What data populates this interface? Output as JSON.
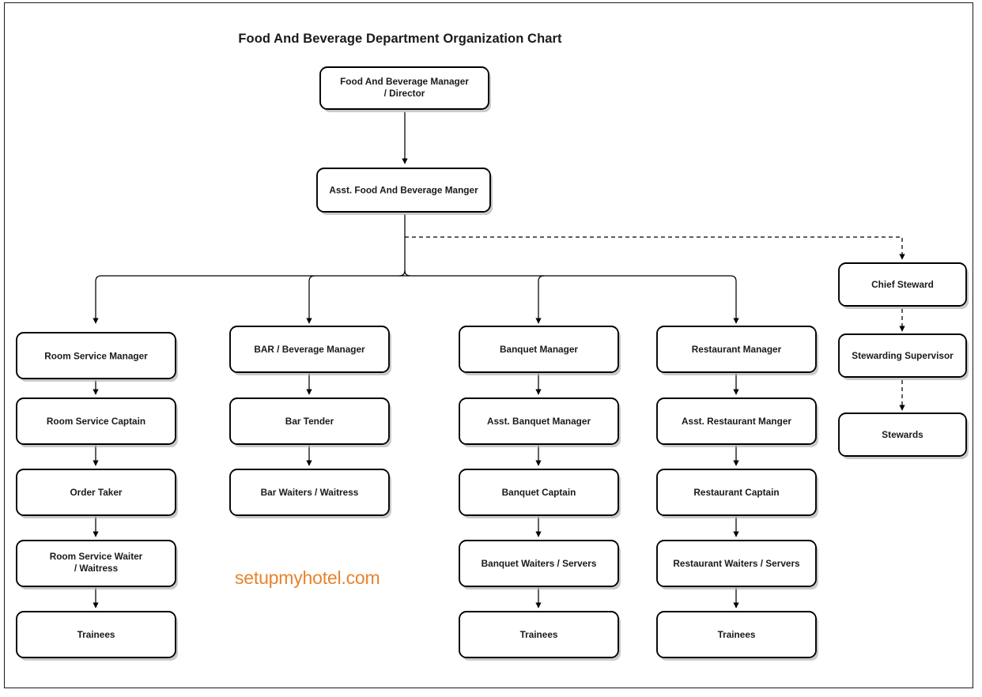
{
  "title": "Food And Beverage Department Organization Chart",
  "watermark": "setupmyhotel.com",
  "colors": {
    "watermark": "#e8832b",
    "node_stroke": "#000000",
    "node_fill": "#ffffff",
    "link": "#000000",
    "page_border": "#1a1a1a"
  },
  "chart_data": {
    "type": "diagram",
    "chart_kind": "organization-chart",
    "title": "Food And Beverage Department Organization Chart",
    "orientation": "top-down",
    "nodes": [
      {
        "id": "fb_manager",
        "label_line1": "Food And Beverage Manager",
        "label_line2": "/ Director",
        "level": 0,
        "column": "root"
      },
      {
        "id": "asst_fb",
        "label_line1": "Asst. Food And Beverage Manger",
        "label_line2": "",
        "level": 1,
        "column": "root"
      },
      {
        "id": "rs_manager",
        "label_line1": "Room Service Manager",
        "label_line2": "",
        "level": 2,
        "column": "room_service"
      },
      {
        "id": "rs_captain",
        "label_line1": "Room Service Captain",
        "label_line2": "",
        "level": 3,
        "column": "room_service"
      },
      {
        "id": "order_taker",
        "label_line1": "Order Taker",
        "label_line2": "",
        "level": 4,
        "column": "room_service"
      },
      {
        "id": "rs_waiter",
        "label_line1": "Room Service Waiter",
        "label_line2": "/ Waitress",
        "level": 5,
        "column": "room_service"
      },
      {
        "id": "rs_trainees",
        "label_line1": "Trainees",
        "label_line2": "",
        "level": 6,
        "column": "room_service"
      },
      {
        "id": "bar_manager",
        "label_line1": "BAR / Beverage Manager",
        "label_line2": "",
        "level": 2,
        "column": "bar"
      },
      {
        "id": "bar_tender",
        "label_line1": "Bar Tender",
        "label_line2": "",
        "level": 3,
        "column": "bar"
      },
      {
        "id": "bar_waiters",
        "label_line1": "Bar Waiters / Waitress",
        "label_line2": "",
        "level": 4,
        "column": "bar"
      },
      {
        "id": "bq_manager",
        "label_line1": "Banquet Manager",
        "label_line2": "",
        "level": 2,
        "column": "banquet"
      },
      {
        "id": "bq_asst",
        "label_line1": "Asst. Banquet Manager",
        "label_line2": "",
        "level": 3,
        "column": "banquet"
      },
      {
        "id": "bq_captain",
        "label_line1": "Banquet Captain",
        "label_line2": "",
        "level": 4,
        "column": "banquet"
      },
      {
        "id": "bq_waiters",
        "label_line1": "Banquet Waiters / Servers",
        "label_line2": "",
        "level": 5,
        "column": "banquet"
      },
      {
        "id": "bq_trainees",
        "label_line1": "Trainees",
        "label_line2": "",
        "level": 6,
        "column": "banquet"
      },
      {
        "id": "rest_manager",
        "label_line1": "Restaurant Manager",
        "label_line2": "",
        "level": 2,
        "column": "restaurant"
      },
      {
        "id": "rest_asst",
        "label_line1": "Asst. Restaurant Manger",
        "label_line2": "",
        "level": 3,
        "column": "restaurant"
      },
      {
        "id": "rest_captain",
        "label_line1": "Restaurant Captain",
        "label_line2": "",
        "level": 4,
        "column": "restaurant"
      },
      {
        "id": "rest_waiters",
        "label_line1": "Restaurant Waiters / Servers",
        "label_line2": "",
        "level": 5,
        "column": "restaurant"
      },
      {
        "id": "rest_trainees",
        "label_line1": "Trainees",
        "label_line2": "",
        "level": 6,
        "column": "restaurant"
      },
      {
        "id": "chief_steward",
        "label_line1": "Chief Steward",
        "label_line2": "",
        "level": 2,
        "column": "stewarding"
      },
      {
        "id": "stew_sup",
        "label_line1": "Stewarding Supervisor",
        "label_line2": "",
        "level": 3,
        "column": "stewarding"
      },
      {
        "id": "stewards",
        "label_line1": "Stewards",
        "label_line2": "",
        "level": 4,
        "column": "stewarding"
      }
    ],
    "edges": [
      {
        "from": "fb_manager",
        "to": "asst_fb",
        "style": "solid"
      },
      {
        "from": "asst_fb",
        "to": "rs_manager",
        "style": "solid"
      },
      {
        "from": "asst_fb",
        "to": "bar_manager",
        "style": "solid"
      },
      {
        "from": "asst_fb",
        "to": "bq_manager",
        "style": "solid"
      },
      {
        "from": "asst_fb",
        "to": "rest_manager",
        "style": "solid"
      },
      {
        "from": "asst_fb",
        "to": "chief_steward",
        "style": "dashed"
      },
      {
        "from": "rs_manager",
        "to": "rs_captain",
        "style": "solid"
      },
      {
        "from": "rs_captain",
        "to": "order_taker",
        "style": "solid"
      },
      {
        "from": "order_taker",
        "to": "rs_waiter",
        "style": "solid"
      },
      {
        "from": "rs_waiter",
        "to": "rs_trainees",
        "style": "solid"
      },
      {
        "from": "bar_manager",
        "to": "bar_tender",
        "style": "solid"
      },
      {
        "from": "bar_tender",
        "to": "bar_waiters",
        "style": "solid"
      },
      {
        "from": "bq_manager",
        "to": "bq_asst",
        "style": "solid"
      },
      {
        "from": "bq_asst",
        "to": "bq_captain",
        "style": "solid"
      },
      {
        "from": "bq_captain",
        "to": "bq_waiters",
        "style": "solid"
      },
      {
        "from": "bq_waiters",
        "to": "bq_trainees",
        "style": "solid"
      },
      {
        "from": "rest_manager",
        "to": "rest_asst",
        "style": "solid"
      },
      {
        "from": "rest_asst",
        "to": "rest_captain",
        "style": "solid"
      },
      {
        "from": "rest_captain",
        "to": "rest_waiters",
        "style": "solid"
      },
      {
        "from": "rest_waiters",
        "to": "rest_trainees",
        "style": "solid"
      },
      {
        "from": "chief_steward",
        "to": "stew_sup",
        "style": "dashed"
      },
      {
        "from": "stew_sup",
        "to": "stewards",
        "style": "dashed"
      }
    ]
  }
}
